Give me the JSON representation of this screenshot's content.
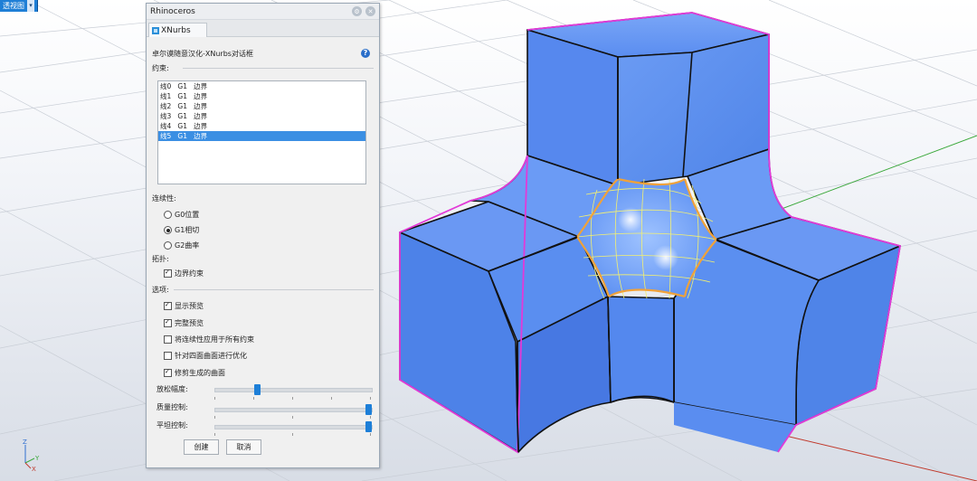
{
  "viewport": {
    "tab_label": "透视图",
    "tab_arrow": "▾",
    "axis": {
      "x": "X",
      "y": "Y",
      "z": "Z"
    }
  },
  "dialog": {
    "title": "Rhinoceros",
    "tab_label": "XNurbs",
    "header": "卓尔谟随意汉化-XNurbs对话框",
    "constraints_label": "约束:",
    "constraints": [
      "线0   G1   边界",
      "线1   G1   边界",
      "线2   G1   边界",
      "线3   G1   边界",
      "线4   G1   边界",
      "线5   G1   边界"
    ],
    "selected_index": 5,
    "continuity_label": "连续性:",
    "continuity_options": [
      "G0位置",
      "G1相切",
      "G2曲率"
    ],
    "continuity_selected": 1,
    "topology_label": "拓扑:",
    "boundary_constraint": "边界约束",
    "options_label": "选项:",
    "options": [
      {
        "label": "显示预览",
        "checked": true
      },
      {
        "label": "完整预览",
        "checked": true
      },
      {
        "label": "将连续性应用于所有约束",
        "checked": false
      },
      {
        "label": "针对四面曲面进行优化",
        "checked": false
      },
      {
        "label": "修剪生成的曲面",
        "checked": true
      }
    ],
    "sliders": [
      {
        "label": "放松幅度:",
        "value": 0.26
      },
      {
        "label": "质量控制:",
        "value": 1.0
      },
      {
        "label": "平坦控制:",
        "value": 1.0
      }
    ],
    "create_button": "创建",
    "cancel_button": "取消"
  },
  "colors": {
    "solid_face": "#5b8ff0",
    "edge_highlight": "#e23ad8",
    "patch_curve": "#f0a23a",
    "patch_grid": "#f3f070",
    "selection": "#3b8fe3"
  }
}
